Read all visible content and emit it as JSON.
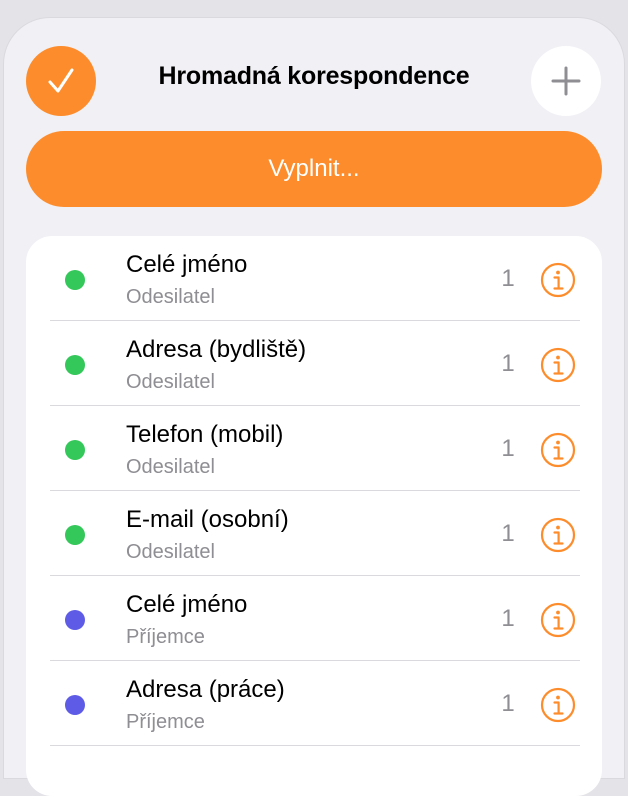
{
  "header": {
    "title": "Hromadná korespondence"
  },
  "fill_button": {
    "label": "Vyplnit..."
  },
  "colors": {
    "accent": "#fd8d2c",
    "sender_dot": "#34c759",
    "recipient_dot": "#5e5ce6"
  },
  "icons": {
    "done": "checkmark-icon",
    "add": "plus-icon",
    "info": "info-circle-icon"
  },
  "fields": [
    {
      "title": "Celé jméno",
      "subtitle": "Odesilatel",
      "count": "1",
      "dot_color": "#34c759"
    },
    {
      "title": "Adresa (bydliště)",
      "subtitle": "Odesilatel",
      "count": "1",
      "dot_color": "#34c759"
    },
    {
      "title": "Telefon (mobil)",
      "subtitle": "Odesilatel",
      "count": "1",
      "dot_color": "#34c759"
    },
    {
      "title": "E-mail (osobní)",
      "subtitle": "Odesilatel",
      "count": "1",
      "dot_color": "#34c759"
    },
    {
      "title": "Celé jméno",
      "subtitle": "Příjemce",
      "count": "1",
      "dot_color": "#5e5ce6"
    },
    {
      "title": "Adresa (práce)",
      "subtitle": "Příjemce",
      "count": "1",
      "dot_color": "#5e5ce6"
    }
  ]
}
